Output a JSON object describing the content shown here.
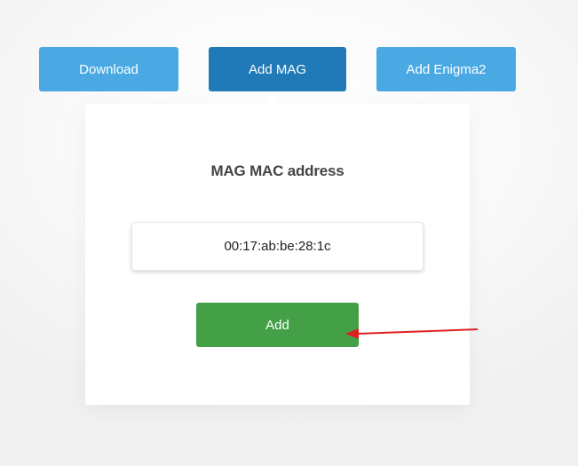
{
  "tabs": {
    "download_label": "Download",
    "add_mag_label": "Add MAG",
    "add_enigma2_label": "Add Enigma2"
  },
  "panel": {
    "title": "MAG MAC address",
    "mac_value": "00:17:ab:be:28:1c",
    "add_button_label": "Add"
  },
  "colors": {
    "tab_inactive": "#4aa9e3",
    "tab_active": "#1f7ab7",
    "add_button": "#43a047",
    "annotation_arrow": "#e02020"
  }
}
